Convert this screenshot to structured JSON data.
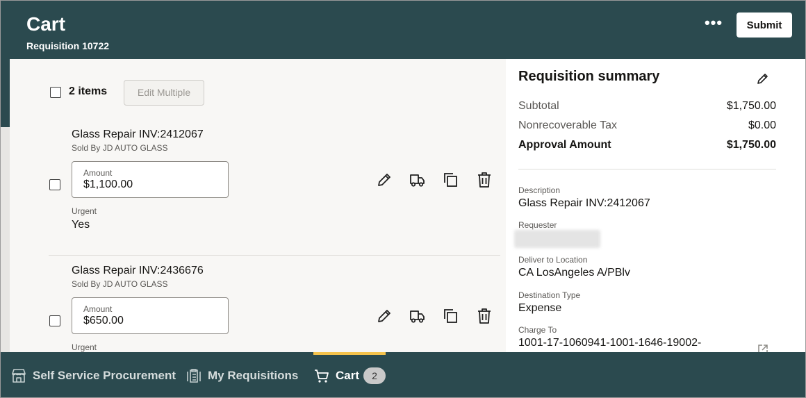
{
  "header": {
    "title": "Cart",
    "subtitle": "Requisition 10722",
    "more_label": "•••",
    "submit_label": "Submit"
  },
  "toolbar": {
    "items_count": "2 items",
    "edit_multiple_label": "Edit Multiple"
  },
  "lines": [
    {
      "title": "Glass Repair INV:2412067",
      "sold_by": "Sold By JD AUTO GLASS",
      "amount_label": "Amount",
      "amount_value": "$1,100.00",
      "urgent_label": "Urgent",
      "urgent_value": "Yes"
    },
    {
      "title": "Glass Repair INV:2436676",
      "sold_by": "Sold By JD AUTO GLASS",
      "amount_label": "Amount",
      "amount_value": "$650.00",
      "urgent_label": "Urgent",
      "urgent_value": ""
    }
  ],
  "summary": {
    "title": "Requisition summary",
    "subtotal_label": "Subtotal",
    "subtotal_value": "$1,750.00",
    "tax_label": "Nonrecoverable Tax",
    "tax_value": "$0.00",
    "approval_label": "Approval Amount",
    "approval_value": "$1,750.00",
    "description_label": "Description",
    "description_value": "Glass Repair INV:2412067",
    "requester_label": "Requester",
    "deliver_label": "Deliver to Location",
    "deliver_value": "CA LosAngeles A/PBlv",
    "destination_label": "Destination Type",
    "destination_value": "Expense",
    "charge_label": "Charge To",
    "charge_value": "1001-17-1060941-1001-1646-19002-"
  },
  "nav": {
    "items": [
      {
        "label": "Self Service Procurement",
        "icon": "store-icon"
      },
      {
        "label": "My Requisitions",
        "icon": "clipboard-icon"
      },
      {
        "label": "Cart",
        "icon": "cart-icon",
        "badge": "2"
      }
    ]
  },
  "colors": {
    "header_bg": "#2b4a4f",
    "nav_active": "#f5c34c",
    "surface": "#f8f7f5"
  }
}
